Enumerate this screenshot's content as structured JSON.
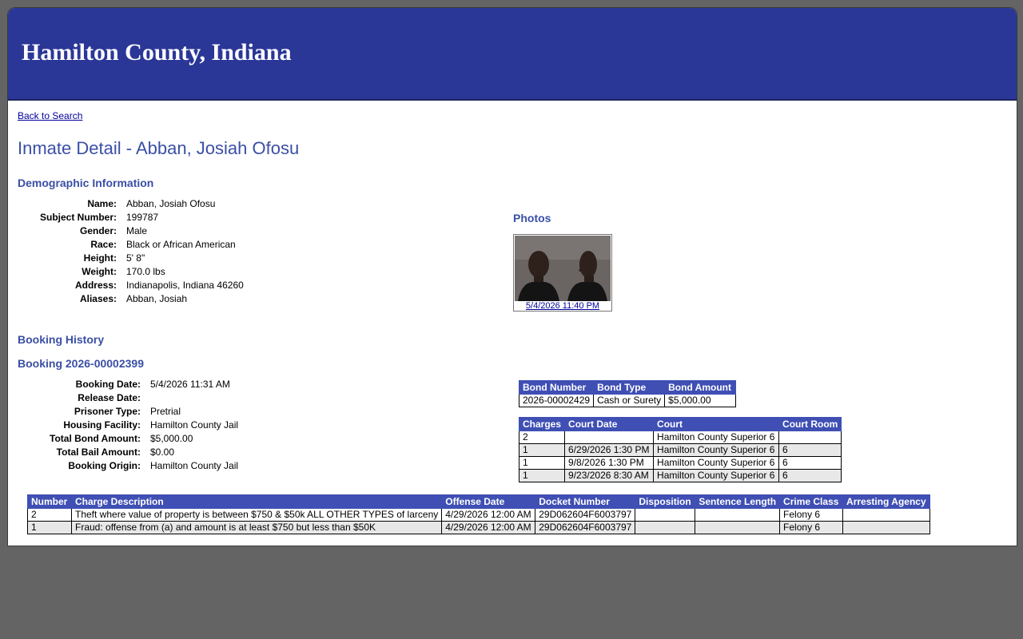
{
  "header": {
    "title": "Hamilton County, Indiana"
  },
  "nav": {
    "back_label": "Back to Search"
  },
  "page": {
    "title": "Inmate Detail - Abban, Josiah Ofosu"
  },
  "demographics": {
    "heading": "Demographic Information",
    "fields": [
      {
        "label": "Name:",
        "value": "Abban, Josiah Ofosu"
      },
      {
        "label": "Subject Number:",
        "value": "199787"
      },
      {
        "label": "Gender:",
        "value": "Male"
      },
      {
        "label": "Race:",
        "value": "Black or African American"
      },
      {
        "label": "Height:",
        "value": "5' 8\""
      },
      {
        "label": "Weight:",
        "value": "170.0 lbs"
      },
      {
        "label": "Address:",
        "value": "Indianapolis, Indiana 46260"
      },
      {
        "label": "Aliases:",
        "value": "Abban, Josiah"
      }
    ]
  },
  "photos": {
    "heading": "Photos",
    "caption": "5/4/2026 11:40 PM"
  },
  "booking_history": {
    "heading": "Booking History"
  },
  "booking": {
    "heading": "Booking 2026-00002399",
    "fields": [
      {
        "label": "Booking Date:",
        "value": "5/4/2026 11:31 AM"
      },
      {
        "label": "Release Date:",
        "value": ""
      },
      {
        "label": "Prisoner Type:",
        "value": "Pretrial"
      },
      {
        "label": "Housing Facility:",
        "value": "Hamilton County Jail"
      },
      {
        "label": "Total Bond Amount:",
        "value": "$5,000.00"
      },
      {
        "label": "Total Bail Amount:",
        "value": "$0.00"
      },
      {
        "label": "Booking Origin:",
        "value": "Hamilton County Jail"
      }
    ]
  },
  "bonds": {
    "headers": [
      "Bond Number",
      "Bond Type",
      "Bond Amount"
    ],
    "rows": [
      [
        "2026-00002429",
        "Cash or Surety",
        "$5,000.00"
      ]
    ]
  },
  "courts": {
    "headers": [
      "Charges",
      "Court Date",
      "Court",
      "Court Room"
    ],
    "rows": [
      [
        "2",
        "",
        "Hamilton County Superior 6",
        ""
      ],
      [
        "1",
        "6/29/2026 1:30 PM",
        "Hamilton County Superior 6",
        "6"
      ],
      [
        "1",
        "9/8/2026 1:30 PM",
        "Hamilton County Superior 6",
        "6"
      ],
      [
        "1",
        "9/23/2026 8:30 AM",
        "Hamilton County Superior 6",
        "6"
      ]
    ]
  },
  "charges": {
    "headers": [
      "Number",
      "Charge Description",
      "Offense Date",
      "Docket Number",
      "Disposition",
      "Sentence Length",
      "Crime Class",
      "Arresting Agency"
    ],
    "rows": [
      [
        "2",
        "Theft where value of property is between $750 & $50k ALL OTHER TYPES of larceny",
        "4/29/2026 12:00 AM",
        "29D062604F6003797",
        "",
        "",
        "Felony 6",
        ""
      ],
      [
        "1",
        "Fraud: offense from (a) and amount is at least $750 but less than $50K",
        "4/29/2026 12:00 AM",
        "29D062604F6003797",
        "",
        "",
        "Felony 6",
        ""
      ]
    ]
  }
}
